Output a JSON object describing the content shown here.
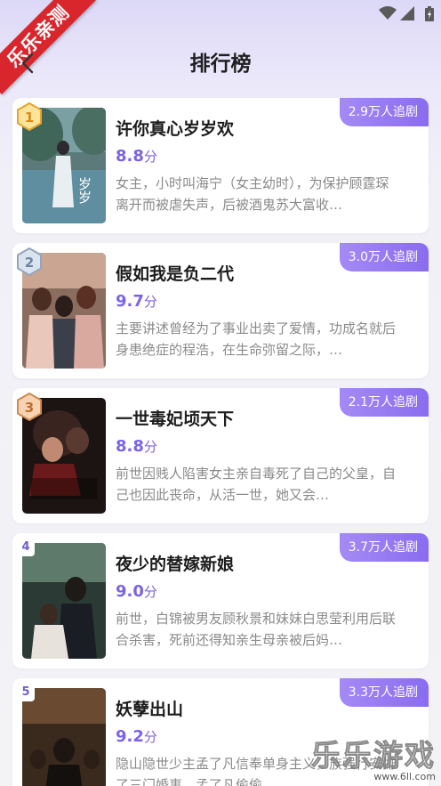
{
  "header": {
    "title": "排行榜",
    "corner_banner": "乐乐亲测"
  },
  "status_bar": {
    "icons": [
      "wifi-icon",
      "cell-signal-icon",
      "battery-icon"
    ]
  },
  "items": [
    {
      "rank": "1",
      "title": "许你真心岁岁欢",
      "score": "8.8",
      "score_unit": "分",
      "followers": "2.9万人追剧",
      "desc": "女主，小时叫海宁（女主幼时），为保护顾霆琛离开而被虐失声，后被酒鬼苏大富收…"
    },
    {
      "rank": "2",
      "title": "假如我是负二代",
      "score": "9.7",
      "score_unit": "分",
      "followers": "3.0万人追剧",
      "desc": "主要讲述曾经为了事业出卖了爱情，功成名就后身患绝症的程浩，在生命弥留之际，…"
    },
    {
      "rank": "3",
      "title": "一世毒妃顷天下",
      "score": "8.8",
      "score_unit": "分",
      "followers": "2.1万人追剧",
      "desc": "前世因贱人陷害女主亲自毒死了自己的父皇，自己也因此丧命，从活一世，她又会…"
    },
    {
      "rank": "4",
      "title": "夜少的替嫁新娘",
      "score": "9.0",
      "score_unit": "分",
      "followers": "3.7万人追剧",
      "desc": "前世，白锦被男友顾秋景和妹妹白思莹利用后联合杀害，死前还得知亲生母亲被后妈…"
    },
    {
      "rank": "5",
      "title": "妖孽出山",
      "score": "9.2",
      "score_unit": "分",
      "followers": "3.3万人追剧",
      "desc": "隐山隐世少主孟了凡信奉单身主义，族强行安排了三门婚事，孟了凡偷偷…"
    }
  ],
  "watermark": {
    "text": "乐乐游戏",
    "url": "www.6ll.com"
  },
  "colors": {
    "accent": "#7a63e8",
    "tag": "#9b7ff2",
    "banner": "#d9262c"
  }
}
